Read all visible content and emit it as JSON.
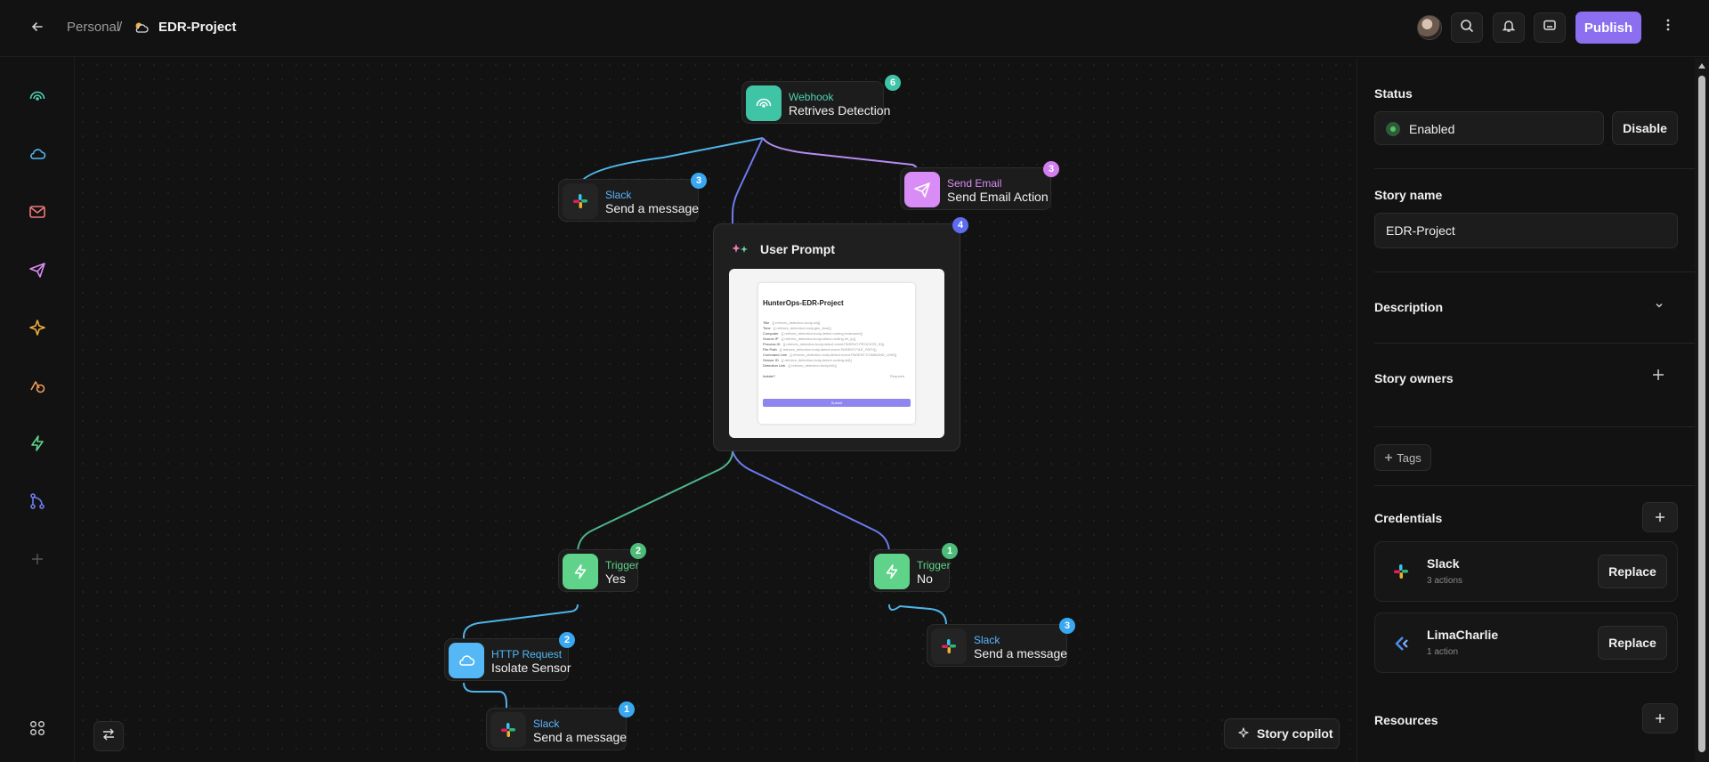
{
  "topbar": {
    "breadcrumb_personal": "Personal",
    "breadcrumb_sep": "/",
    "project_name": "EDR-Project",
    "publish_label": "Publish"
  },
  "canvas": {
    "nodes": {
      "webhook": {
        "type": "Webhook",
        "name": "Retrives Detection",
        "badge": "6"
      },
      "slack_top": {
        "type": "Slack",
        "name": "Send a message",
        "badge": "3"
      },
      "email": {
        "type": "Send Email",
        "name": "Send Email Action",
        "badge": "3"
      },
      "user_prompt": {
        "name": "User Prompt",
        "badge": "4"
      },
      "trigger_yes": {
        "type": "Trigger",
        "name": "Yes",
        "badge": "2"
      },
      "trigger_no": {
        "type": "Trigger",
        "name": "No",
        "badge": "1"
      },
      "http": {
        "type": "HTTP Request",
        "name": "Isolate Sensor",
        "badge": "2"
      },
      "slack_bottom_left": {
        "type": "Slack",
        "name": "Send a message",
        "badge": "1"
      },
      "slack_bottom_right": {
        "type": "Slack",
        "name": "Send a message",
        "badge": "3"
      }
    },
    "form_preview": {
      "title": "HunterOps-EDR-Project",
      "fields": [
        {
          "label": "Title",
          "value": "{{.retrives_detection.body.cat}}"
        },
        {
          "label": "Time",
          "value": "{{.retrives_detection.body.gen_time}}"
        },
        {
          "label": "Computer",
          "value": "{{.retrives_detection.body.detect.routing.hostname}}"
        },
        {
          "label": "Source IP",
          "value": "{{.retrives_detection.body.detect.routing.int_ip}}"
        },
        {
          "label": "Process ID",
          "value": "{{.retrives_detection.body.detect.event.PARENT.PROCESS_ID}}"
        },
        {
          "label": "File Path",
          "value": "{{.retrives_detection.body.detect.event.PARENT.FILE_PATH}}"
        },
        {
          "label": "Command Line",
          "value": "{{.retrives_detection.body.detect.event.PARENT.COMMAND_LINE}}"
        },
        {
          "label": "Sensor ID",
          "value": "{{.retrives_detection.body.detect.routing.sid}}"
        },
        {
          "label": "Detection Link",
          "value": "{{.retrives_detection.body.link}}"
        }
      ],
      "isolate_label": "Isolate?",
      "required_label": "Required",
      "submit_label": "Submit"
    },
    "story_copilot_label": "Story copilot"
  },
  "panel": {
    "status_label": "Status",
    "status_value": "Enabled",
    "disable_label": "Disable",
    "story_name_label": "Story name",
    "story_name_value": "EDR-Project",
    "description_label": "Description",
    "story_owners_label": "Story owners",
    "tags_label": "Tags",
    "credentials_label": "Credentials",
    "credentials": [
      {
        "name": "Slack",
        "sub": "3 actions",
        "button": "Replace"
      },
      {
        "name": "LimaCharlie",
        "sub": "1 action",
        "button": "Replace"
      }
    ],
    "resources_label": "Resources"
  },
  "icons": {
    "leftrail": [
      "webhook-icon",
      "http-request-icon",
      "email-icon",
      "send-email-icon",
      "ai-sparkle-icon",
      "tools-icon",
      "trigger-icon",
      "branch-icon",
      "plus-icon",
      "apps-grid-icon"
    ],
    "topbar": [
      "back-arrow-icon",
      "cloud-sun-icon",
      "search-icon",
      "bell-icon",
      "comment-icon",
      "kebab-icon"
    ]
  },
  "colors": {
    "webhook": "#4fd1b0",
    "slack_type": "#5bb4ff",
    "email": "#d98cf5",
    "trigger": "#5fd38a",
    "http": "#53b8f5",
    "prompt_line": "#6c7cf0",
    "publish": "#8b6ff0"
  }
}
